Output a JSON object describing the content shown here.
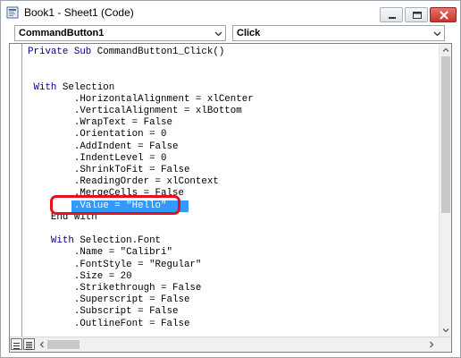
{
  "window": {
    "title": "Book1 - Sheet1 (Code)",
    "icons": {
      "app": "vba-module-icon",
      "minimize": "minimize-icon",
      "maximize": "maximize-icon",
      "close": "close-icon"
    },
    "colors": {
      "close_button": "#c7362b",
      "selection": "#3399ff",
      "annotation": "#e5121b",
      "keyword": "#00008b"
    }
  },
  "selectors": {
    "object_value": "CommandButton1",
    "procedure_value": "Click"
  },
  "code": {
    "lines": [
      {
        "kw": "Private Sub ",
        "rest": "CommandButton1_Click()"
      },
      {
        "kw": "",
        "rest": ""
      },
      {
        "kw": "",
        "rest": ""
      },
      {
        "kw": " With ",
        "rest": "Selection"
      },
      {
        "kw": "",
        "rest": "        .HorizontalAlignment = xlCenter"
      },
      {
        "kw": "",
        "rest": "        .VerticalAlignment = xlBottom"
      },
      {
        "kw": "",
        "rest": "        .WrapText = False"
      },
      {
        "kw": "",
        "rest": "        .Orientation = 0"
      },
      {
        "kw": "",
        "rest": "        .AddIndent = False"
      },
      {
        "kw": "",
        "rest": "        .IndentLevel = 0"
      },
      {
        "kw": "",
        "rest": "        .ShrinkToFit = False"
      },
      {
        "kw": "",
        "rest": "        .ReadingOrder = xlContext"
      },
      {
        "kw": "",
        "rest": "        .MergeCells = False"
      },
      {
        "kw": "",
        "rest": "        .Value = \"Hello\""
      },
      {
        "kw": "",
        "rest": "    End With"
      },
      {
        "kw": "",
        "rest": ""
      },
      {
        "kw": "    With ",
        "rest": "Selection.Font"
      },
      {
        "kw": "",
        "rest": "        .Name = \"Calibri\""
      },
      {
        "kw": "",
        "rest": "        .FontStyle = \"Regular\""
      },
      {
        "kw": "",
        "rest": "        .Size = 20"
      },
      {
        "kw": "",
        "rest": "        .Strikethrough = False"
      },
      {
        "kw": "",
        "rest": "        .Superscript = False"
      },
      {
        "kw": "",
        "rest": "        .Subscript = False"
      },
      {
        "kw": "",
        "rest": "        .OutlineFont = False"
      }
    ],
    "selected_line_index": 13
  }
}
